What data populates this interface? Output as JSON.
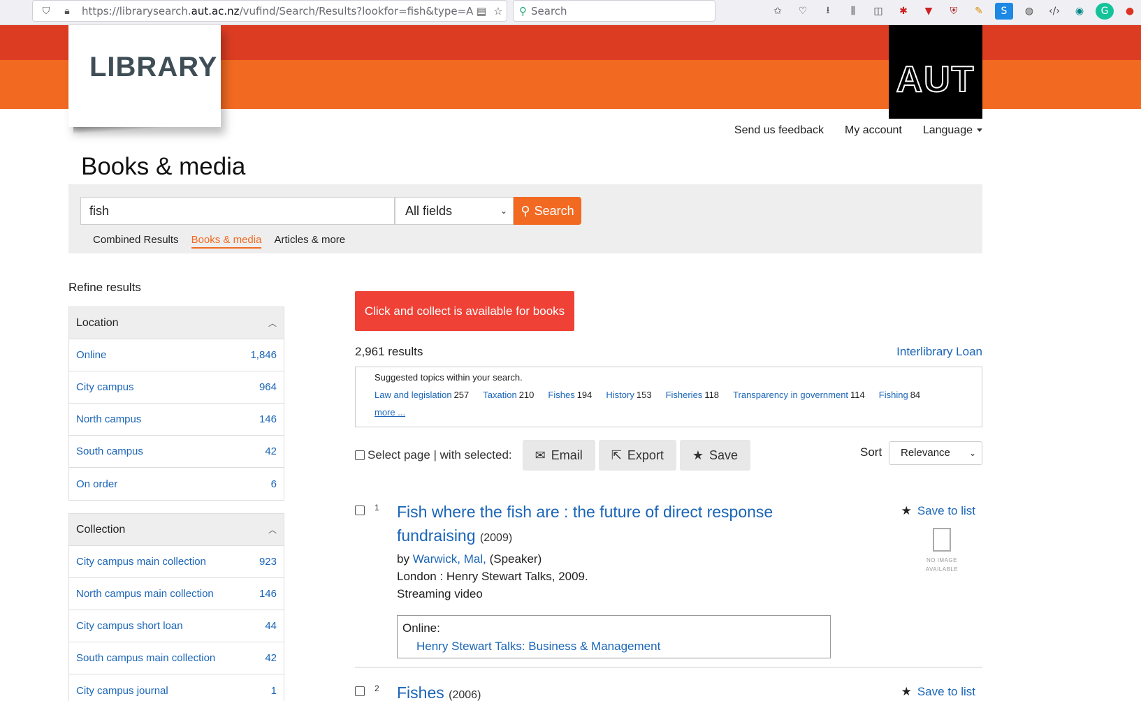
{
  "browser": {
    "url_prefix": "https://librarysearch.",
    "url_domain": "aut.ac.nz",
    "url_rest": "/vufind/Search/Results?lookfor=fish&type=AllFiel",
    "search_placeholder": "Search"
  },
  "header": {
    "library_label": "LIBRARY",
    "aut_logo": "AUT",
    "links": {
      "feedback": "Send us feedback",
      "account": "My account",
      "language": "Language"
    },
    "page_title": "Books & media"
  },
  "search": {
    "query": "fish",
    "field": "All fields",
    "button": "Search",
    "tabs": [
      "Combined Results",
      "Books & media",
      "Articles & more"
    ],
    "active_tab": "Books & media"
  },
  "sidebar": {
    "title": "Refine results",
    "location": {
      "header": "Location",
      "items": [
        {
          "label": "Online",
          "count": "1,846"
        },
        {
          "label": "City campus",
          "count": "964"
        },
        {
          "label": "North campus",
          "count": "146"
        },
        {
          "label": "South campus",
          "count": "42"
        },
        {
          "label": "On order",
          "count": "6"
        }
      ]
    },
    "collection": {
      "header": "Collection",
      "items": [
        {
          "label": "City campus main collection",
          "count": "923"
        },
        {
          "label": "North campus main collection",
          "count": "146"
        },
        {
          "label": "City campus short loan",
          "count": "44"
        },
        {
          "label": "South campus main collection",
          "count": "42"
        },
        {
          "label": "City campus journal",
          "count": "1"
        }
      ]
    }
  },
  "main": {
    "collect_banner": "Click and collect is available for books",
    "result_count": "2,961 results",
    "ill_link": "Interlibrary Loan",
    "topics": {
      "title": "Suggested topics within your search.",
      "items": [
        {
          "label": "Law and legislation",
          "count": "257"
        },
        {
          "label": "Taxation",
          "count": "210"
        },
        {
          "label": "Fishes",
          "count": "194"
        },
        {
          "label": "History",
          "count": "153"
        },
        {
          "label": "Fisheries",
          "count": "118"
        },
        {
          "label": "Transparency in government",
          "count": "114"
        },
        {
          "label": "Fishing",
          "count": "84"
        }
      ],
      "more": "more ..."
    },
    "select_page": "Select page | with selected:",
    "actions": {
      "email": "Email",
      "export": "Export",
      "save": "Save"
    },
    "sort_label": "Sort",
    "sort_value": "Relevance",
    "results": [
      {
        "num": "1",
        "title_line1": "Fish where the fish are : the future of direct response",
        "title_line2": "fundraising",
        "year": "(2009)",
        "by": "by",
        "author": "Warwick, Mal,",
        "role": "(Speaker)",
        "publisher": "London : Henry Stewart Talks, 2009.",
        "format": "Streaming video",
        "save_to_list": "Save to list",
        "noimage_line1": "NO IMAGE",
        "noimage_line2": "AVAILABLE",
        "online_label": "Online:",
        "online_link": "Henry Stewart Talks: Business & Management"
      },
      {
        "num": "2",
        "title_line1": "Fishes",
        "year": "(2006)",
        "save_to_list": "Save to list"
      }
    ]
  }
}
